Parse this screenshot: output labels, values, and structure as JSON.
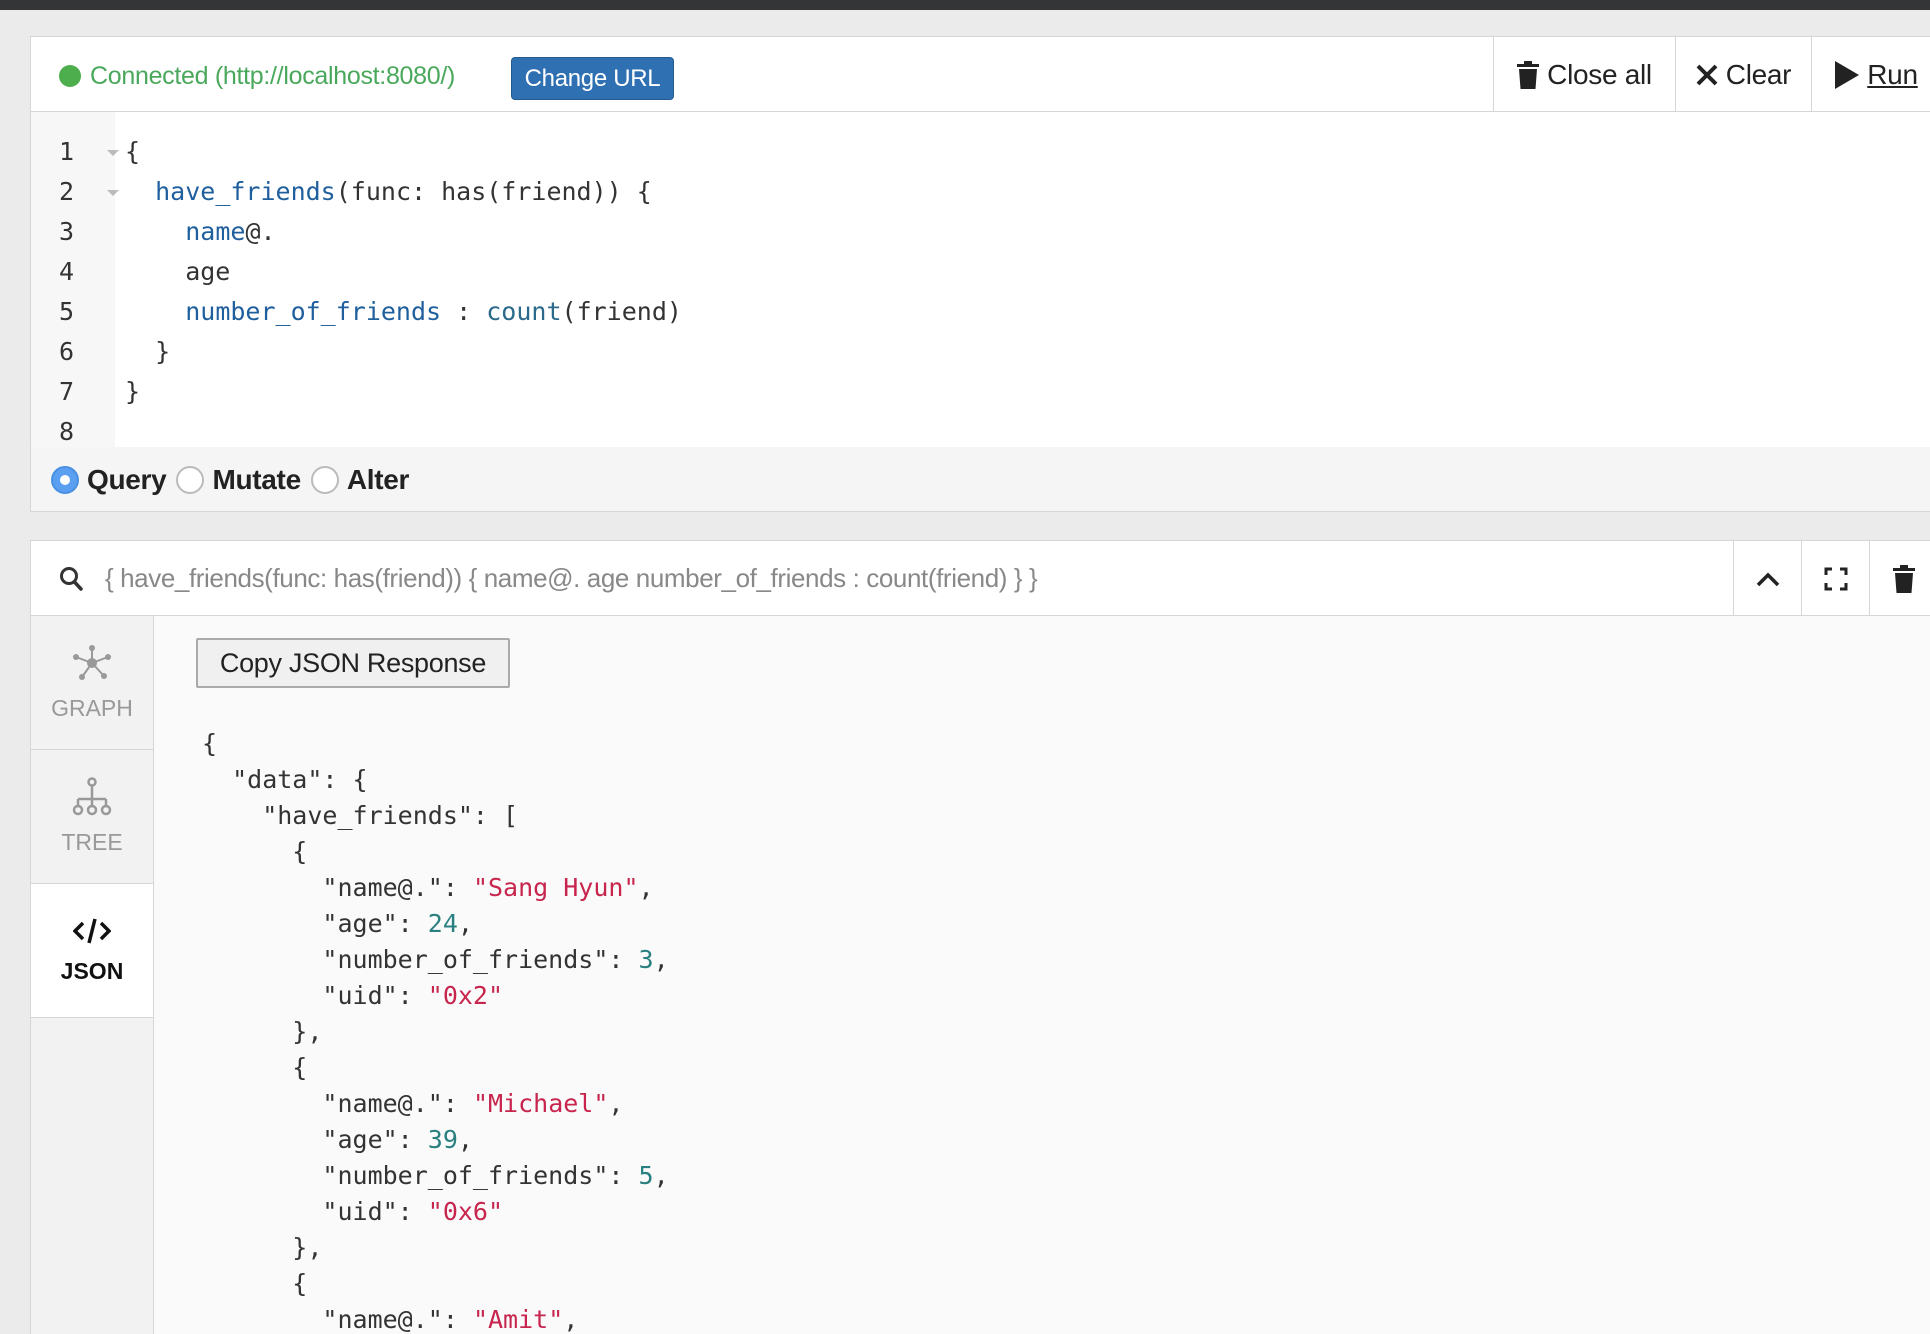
{
  "editor": {
    "status_text": "Connected (http://localhost:8080/)",
    "change_url_label": "Change URL",
    "close_all_label": "Close all",
    "clear_label": "Clear",
    "run_label": "Run",
    "line_numbers": [
      "1",
      "2",
      "3",
      "4",
      "5",
      "6",
      "7",
      "8"
    ],
    "modes": [
      {
        "label": "Query",
        "selected": true
      },
      {
        "label": "Mutate",
        "selected": false
      },
      {
        "label": "Alter",
        "selected": false
      }
    ]
  },
  "result": {
    "query_summary": "{ have_friends(func: has(friend)) { name@. age number_of_friends : count(friend) } }",
    "tabs": [
      {
        "label": "GRAPH"
      },
      {
        "label": "TREE"
      },
      {
        "label": "JSON"
      }
    ],
    "copy_label": "Copy JSON Response",
    "records": [
      {
        "name": "\"Sang Hyun\"",
        "age": "24",
        "friends": "3",
        "uid": "\"0x2\""
      },
      {
        "name": "\"Michael\"",
        "age": "39",
        "friends": "5",
        "uid": "\"0x6\""
      },
      {
        "name": "\"Amit\""
      }
    ]
  },
  "colors": {
    "connected": "#4aa85c",
    "primary_button": "#2f70b2",
    "json_string": "#c7254e",
    "json_number": "#2a8080"
  }
}
